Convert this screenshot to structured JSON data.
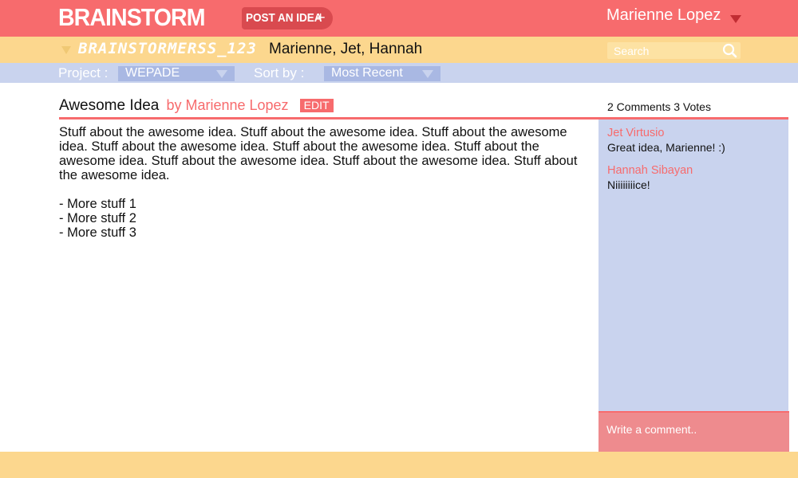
{
  "header": {
    "logo": "BRAINSTORM",
    "post_button_label": "POST AN IDEA",
    "post_button_icon": "plus-icon",
    "user_name": "Marienne Lopez",
    "colors": {
      "header_bg": "#f76b6d",
      "accent_dark": "#d94a4f"
    }
  },
  "board": {
    "name": "BRAINSTORMERSS_123",
    "members": "Marienne, Jet, Hannah",
    "search_placeholder": "Search",
    "search_value": ""
  },
  "filters": {
    "project_label": "Project :",
    "project_value": "WEPADE",
    "sort_label": "Sort by :",
    "sort_value": "Most Recent"
  },
  "idea": {
    "title": "Awesome Idea",
    "by": "by Marienne Lopez",
    "edit_label": "EDIT",
    "counts": "2 Comments  3 Votes",
    "body": "Stuff about the awesome idea. Stuff about the awesome idea. Stuff about the awesome idea.  Stuff about the awesome idea. Stuff about the awesome idea. Stuff about the awesome idea. Stuff about the awesome idea. Stuff about the awesome idea. Stuff about the awesome idea.",
    "bullets": [
      "- More stuff 1",
      "- More stuff 2",
      "- More stuff 3"
    ]
  },
  "comments": [
    {
      "author": "Jet Virtusio",
      "text": "Great idea, Marienne! :)"
    },
    {
      "author": "Hannah Sibayan",
      "text": "Niiiiiiiice!"
    }
  ],
  "comment_input": {
    "placeholder": "Write a comment..",
    "value": ""
  }
}
